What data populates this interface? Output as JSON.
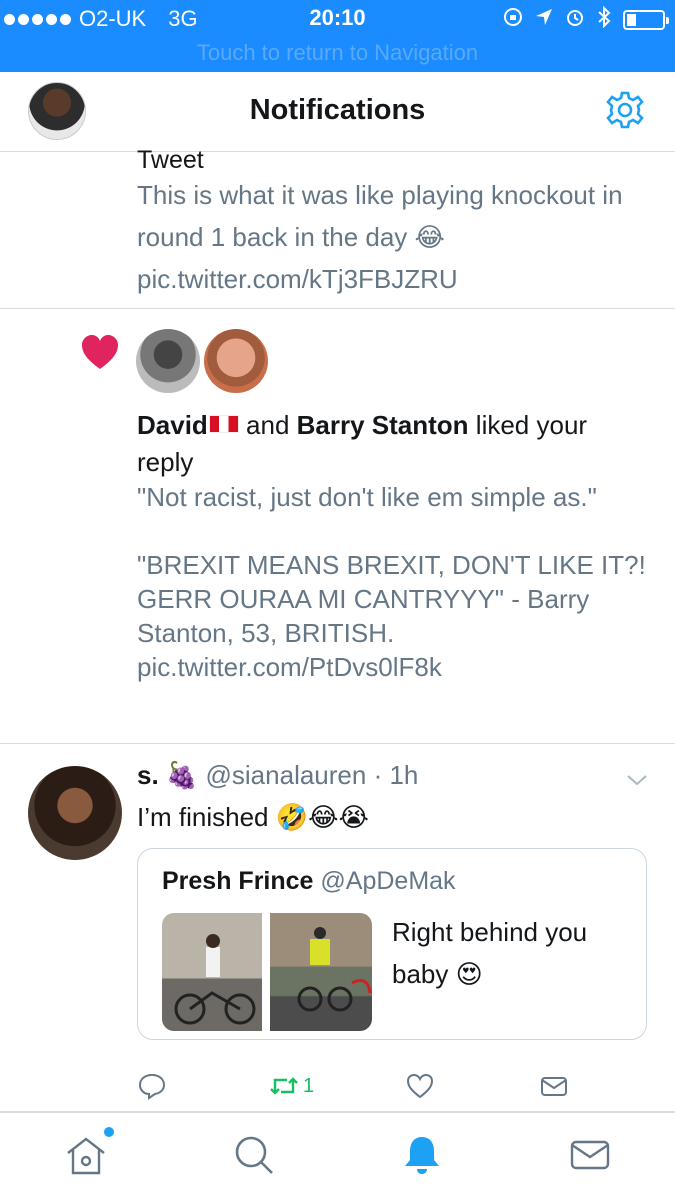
{
  "status_bar": {
    "carrier": "O2-UK",
    "network": "3G",
    "time": "20:10",
    "return_banner": "Touch to return to Navigation",
    "background": "#1a8cff"
  },
  "header": {
    "title": "Notifications",
    "settings_icon": "gear-icon",
    "accent": "#1da1f2"
  },
  "notifications": [
    {
      "label": "Tweet",
      "text": "This is what it was like playing knockout in round 1 back in the day 😂 pic.twitter.com/kTj3FBJZRU"
    },
    {
      "icon": "heart-icon",
      "user1": "David",
      "joiner": " and ",
      "user2": "Barry Stanton",
      "action": " liked your reply",
      "quote": "\"Not racist, just don't like em simple as.\"\n\n\"BREXIT MEANS BREXIT, DON'T LIKE IT?! GERR OURAA MI CANTRYYY\" - Barry Stanton, 53, BRITISH. pic.twitter.com/PtDvs0lF8k"
    },
    {
      "name": "s. 🍇",
      "handle": "@sianalauren",
      "separator": " · ",
      "time": "1h",
      "text": "I’m finished 🤣😂😭",
      "quoted": {
        "name": "Presh Frince",
        "handle": "@ApDeMak",
        "text": "Right behind you baby 😍"
      },
      "actions": {
        "retweet_count": "1"
      }
    }
  ],
  "tab_bar": {
    "items": [
      "home-icon",
      "search-icon",
      "notifications-icon",
      "messages-icon"
    ],
    "active": "notifications-icon"
  }
}
